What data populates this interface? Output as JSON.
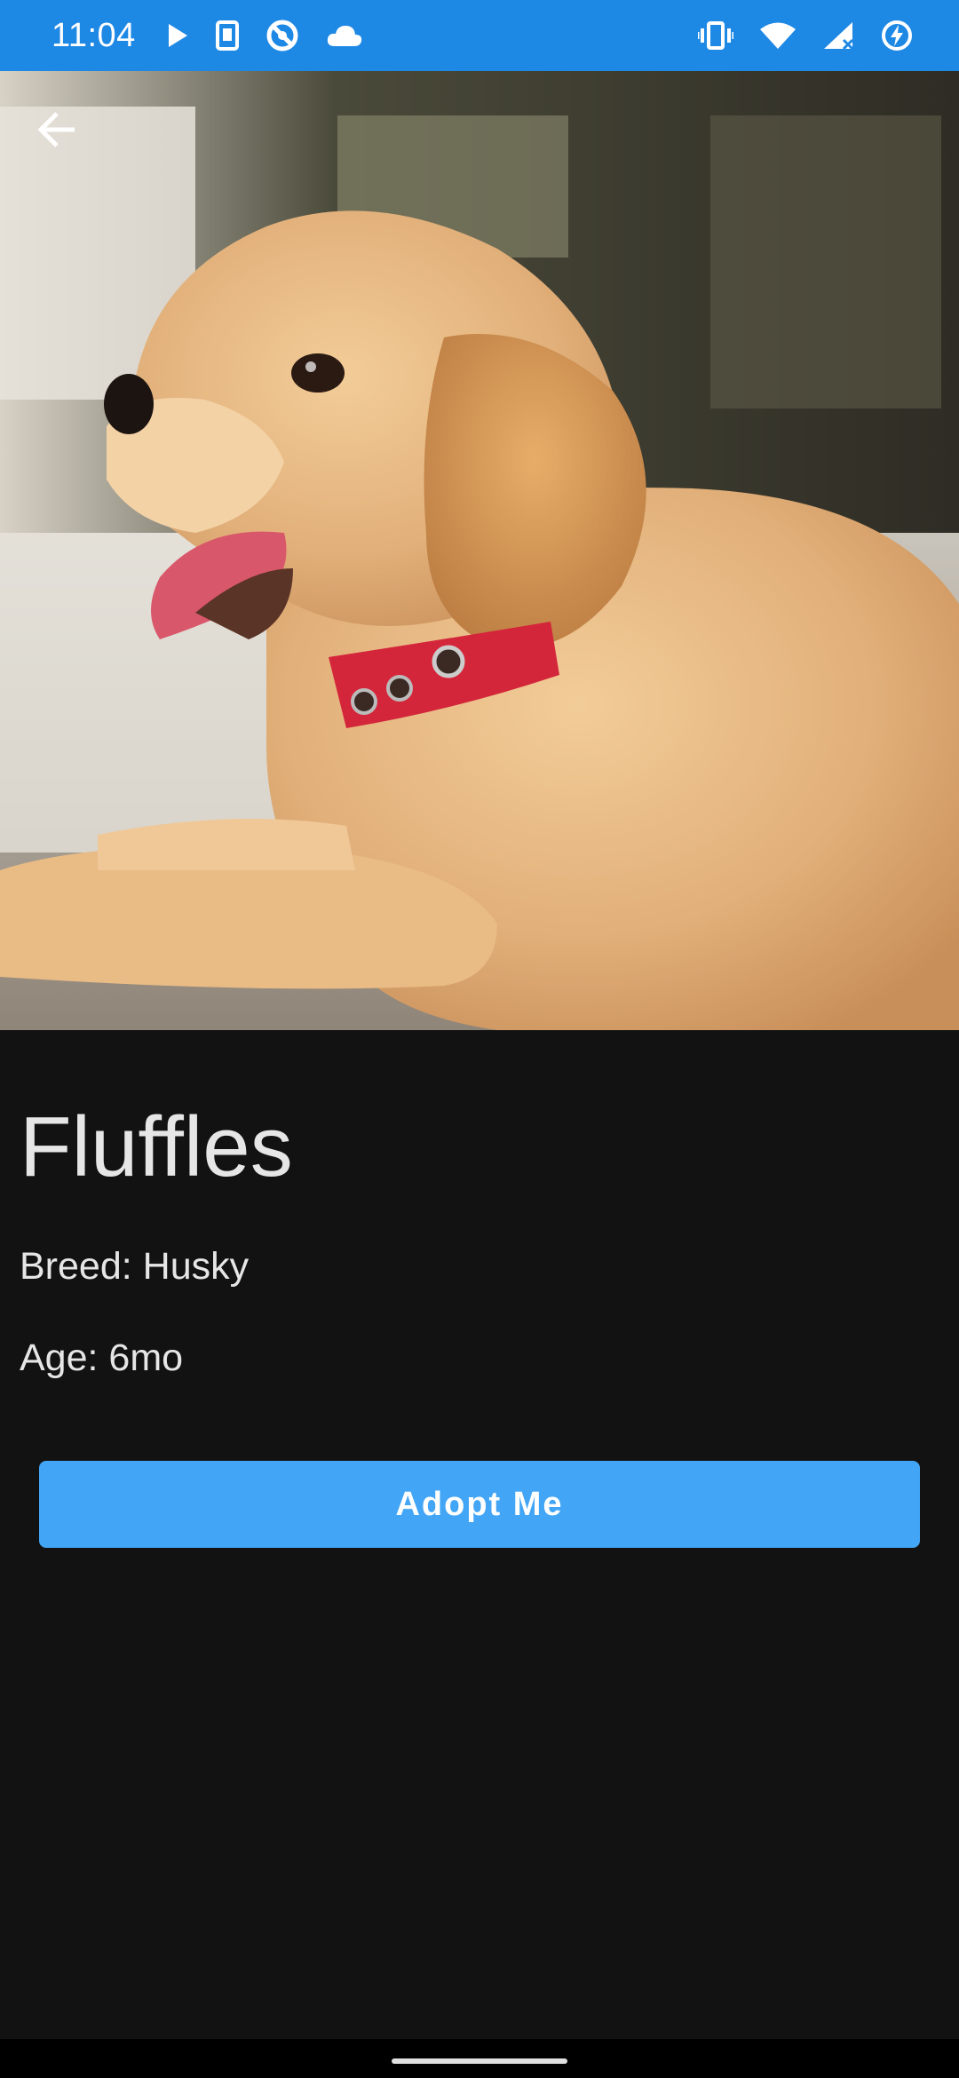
{
  "status_bar": {
    "time": "11:04",
    "background": "#1e88e5",
    "left_icons": [
      "play-icon",
      "sim-icon",
      "no-access-icon",
      "cloud-icon"
    ],
    "right_icons": [
      "vibrate-icon",
      "wifi-icon",
      "signal-icon",
      "battery-saver-icon"
    ]
  },
  "hero": {
    "image": "golden-retriever-puppy-photo",
    "back_icon": "arrow-back-icon"
  },
  "pet": {
    "name": "Fluffles",
    "breed": "Breed: Husky",
    "age": "Age: 6mo"
  },
  "actions": {
    "adopt_label": "Adopt Me",
    "accent": "#42a5f5"
  },
  "theme": {
    "background": "#121212",
    "text": "#e6e6e6"
  }
}
